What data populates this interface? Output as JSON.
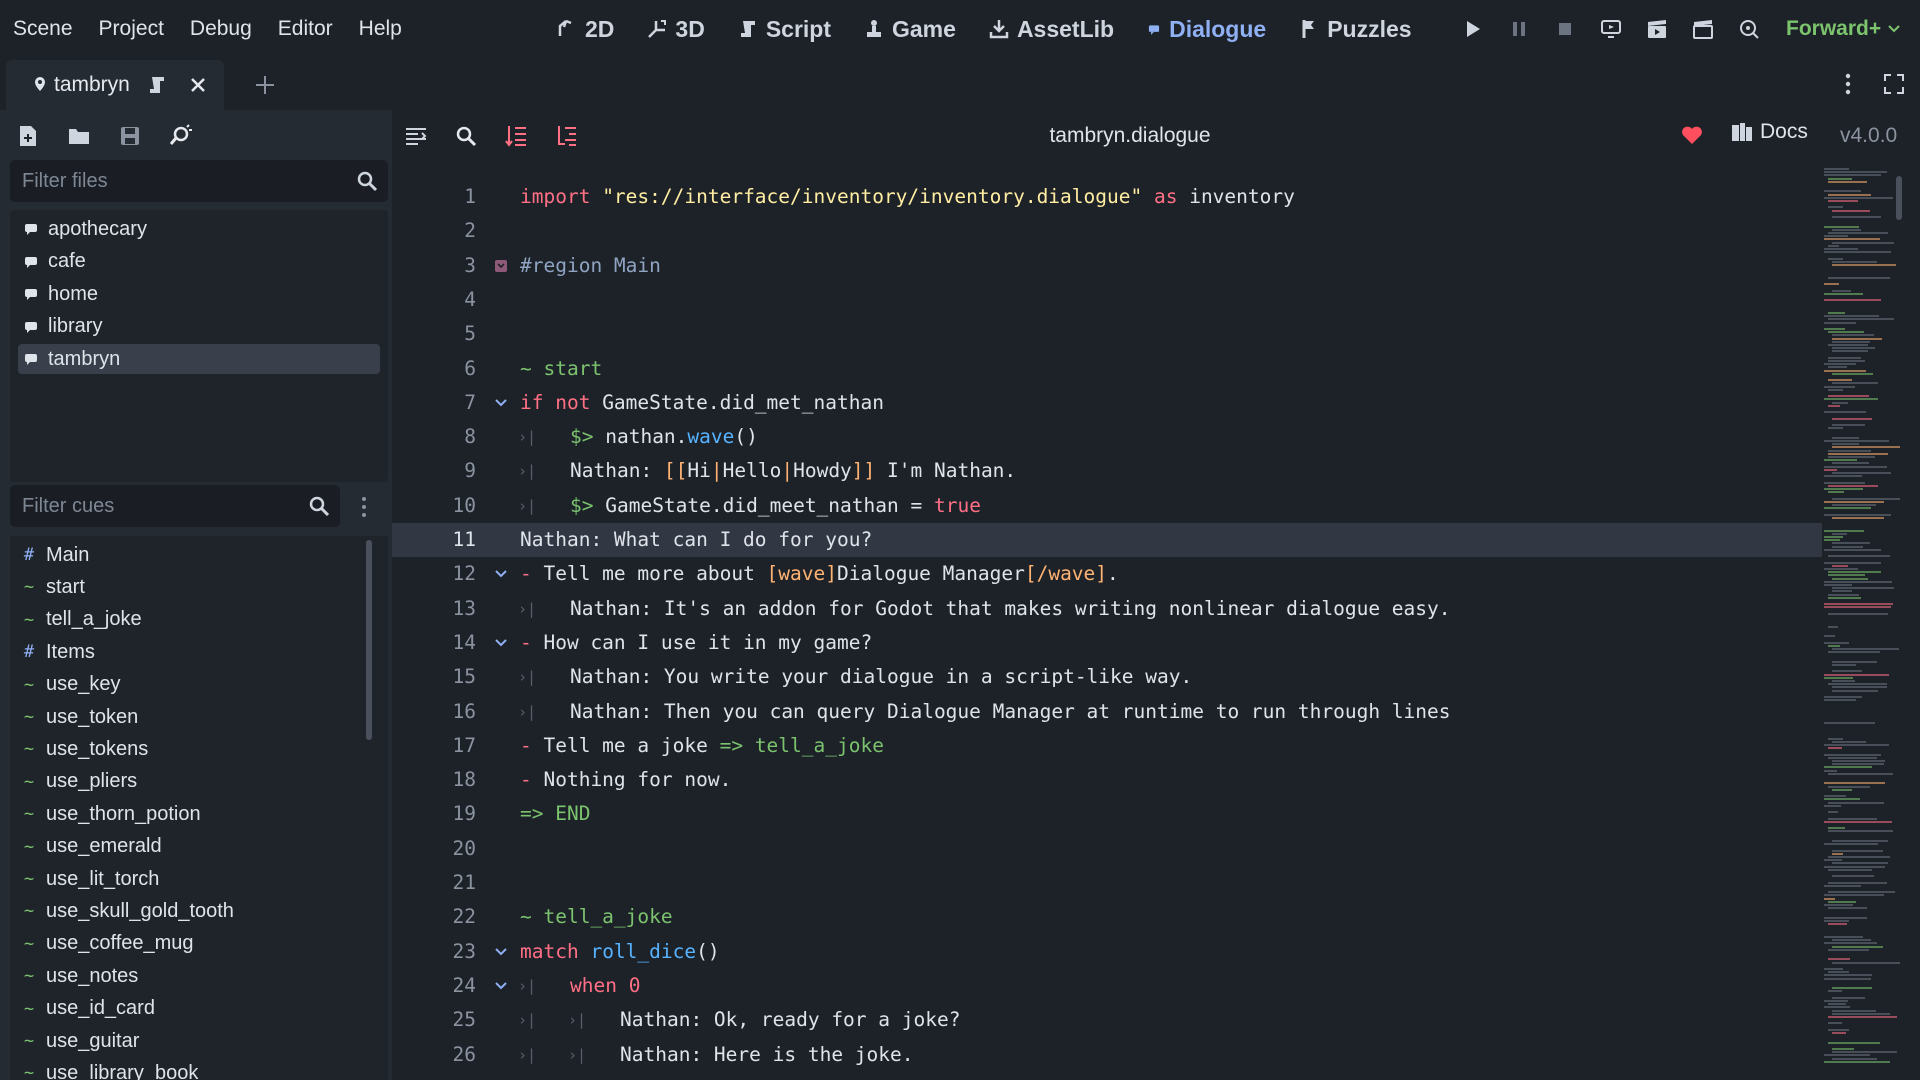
{
  "menu": [
    "Scene",
    "Project",
    "Debug",
    "Editor",
    "Help"
  ],
  "modes": [
    {
      "label": "2D",
      "icon": "2d-icon",
      "active": false
    },
    {
      "label": "3D",
      "icon": "3d-icon",
      "active": false
    },
    {
      "label": "Script",
      "icon": "script-icon",
      "active": false
    },
    {
      "label": "Game",
      "icon": "game-icon",
      "active": false
    },
    {
      "label": "AssetLib",
      "icon": "assetlib-icon",
      "active": false
    },
    {
      "label": "Dialogue",
      "icon": "dialogue-icon",
      "active": true
    },
    {
      "label": "Puzzles",
      "icon": "puzzles-icon",
      "active": false
    }
  ],
  "renderer": "Forward+",
  "tab": {
    "label": "tambryn"
  },
  "files_filter": {
    "placeholder": "Filter files"
  },
  "files": [
    {
      "name": "apothecary",
      "selected": false
    },
    {
      "name": "cafe",
      "selected": false
    },
    {
      "name": "home",
      "selected": false
    },
    {
      "name": "library",
      "selected": false
    },
    {
      "name": "tambryn",
      "selected": true
    }
  ],
  "cues_filter": {
    "placeholder": "Filter cues"
  },
  "cues": [
    {
      "mark": "#",
      "name": "Main"
    },
    {
      "mark": "~",
      "name": "start"
    },
    {
      "mark": "~",
      "name": "tell_a_joke"
    },
    {
      "mark": "#",
      "name": "Items"
    },
    {
      "mark": "~",
      "name": "use_key"
    },
    {
      "mark": "~",
      "name": "use_token"
    },
    {
      "mark": "~",
      "name": "use_tokens"
    },
    {
      "mark": "~",
      "name": "use_pliers"
    },
    {
      "mark": "~",
      "name": "use_thorn_potion"
    },
    {
      "mark": "~",
      "name": "use_emerald"
    },
    {
      "mark": "~",
      "name": "use_lit_torch"
    },
    {
      "mark": "~",
      "name": "use_skull_gold_tooth"
    },
    {
      "mark": "~",
      "name": "use_coffee_mug"
    },
    {
      "mark": "~",
      "name": "use_notes"
    },
    {
      "mark": "~",
      "name": "use_id_card"
    },
    {
      "mark": "~",
      "name": "use_guitar"
    },
    {
      "mark": "~",
      "name": "use_library_book"
    }
  ],
  "editor": {
    "filename": "tambryn.dialogue",
    "docs_label": "Docs",
    "version": "v4.0.0",
    "current_line": 11,
    "lines": [
      {
        "n": "1",
        "indent": 0,
        "fold": "",
        "parts": [
          [
            "kw",
            "import "
          ],
          [
            "str",
            "\"res://interface/inventory/inventory.dialogue\""
          ],
          [
            "kw",
            " as "
          ],
          [
            "",
            "inventory"
          ]
        ]
      },
      {
        "n": "2",
        "indent": 0,
        "fold": "",
        "parts": []
      },
      {
        "n": "3",
        "indent": 0,
        "fold": "region",
        "parts": [
          [
            "cmt",
            "#region Main"
          ]
        ]
      },
      {
        "n": "4",
        "indent": 0,
        "fold": "",
        "parts": []
      },
      {
        "n": "5",
        "indent": 0,
        "fold": "",
        "parts": []
      },
      {
        "n": "6",
        "indent": 0,
        "fold": "",
        "parts": [
          [
            "title",
            "~ start"
          ]
        ]
      },
      {
        "n": "7",
        "indent": 0,
        "fold": "down",
        "parts": [
          [
            "kw",
            "if not "
          ],
          [
            "",
            "GameState.did_met_nathan"
          ]
        ]
      },
      {
        "n": "8",
        "indent": 1,
        "fold": "",
        "parts": [
          [
            "op",
            "$> "
          ],
          [
            "",
            "nathan."
          ],
          [
            "fn",
            "wave"
          ],
          [
            "",
            "()"
          ]
        ]
      },
      {
        "n": "9",
        "indent": 1,
        "fold": "",
        "parts": [
          [
            "",
            "Nathan: "
          ],
          [
            "tag",
            "[["
          ],
          [
            "",
            "Hi"
          ],
          [
            "tag",
            "|"
          ],
          [
            "",
            "Hello"
          ],
          [
            "tag",
            "|"
          ],
          [
            "",
            "Howdy"
          ],
          [
            "tag",
            "]]"
          ],
          [
            "",
            " I'm Nathan."
          ]
        ]
      },
      {
        "n": "10",
        "indent": 1,
        "fold": "",
        "parts": [
          [
            "op",
            "$> "
          ],
          [
            "",
            "GameState.did_meet_nathan = "
          ],
          [
            "bool",
            "true"
          ]
        ]
      },
      {
        "n": "11",
        "indent": 0,
        "fold": "",
        "parts": [
          [
            "",
            "Nathan: What can I do for you?"
          ]
        ]
      },
      {
        "n": "12",
        "indent": 0,
        "fold": "down",
        "parts": [
          [
            "kw",
            "- "
          ],
          [
            "",
            "Tell me more about "
          ],
          [
            "tag",
            "[wave]"
          ],
          [
            "",
            "Dialogue Manager"
          ],
          [
            "tag",
            "[/wave]"
          ],
          [
            "",
            "."
          ]
        ]
      },
      {
        "n": "13",
        "indent": 1,
        "fold": "",
        "parts": [
          [
            "",
            "Nathan: It's an addon for Godot that makes writing nonlinear dialogue easy."
          ]
        ]
      },
      {
        "n": "14",
        "indent": 0,
        "fold": "down",
        "parts": [
          [
            "kw",
            "- "
          ],
          [
            "",
            "How can I use it in my game?"
          ]
        ]
      },
      {
        "n": "15",
        "indent": 1,
        "fold": "",
        "parts": [
          [
            "",
            "Nathan: You write your dialogue in a script-like way."
          ]
        ]
      },
      {
        "n": "16",
        "indent": 1,
        "fold": "",
        "parts": [
          [
            "",
            "Nathan: Then you can query Dialogue Manager at runtime to run through lines"
          ]
        ]
      },
      {
        "n": "17",
        "indent": 0,
        "fold": "",
        "parts": [
          [
            "kw",
            "- "
          ],
          [
            "",
            "Tell me a joke "
          ],
          [
            "op",
            "=> tell_a_joke"
          ]
        ]
      },
      {
        "n": "18",
        "indent": 0,
        "fold": "",
        "parts": [
          [
            "kw",
            "- "
          ],
          [
            "",
            "Nothing for now."
          ]
        ]
      },
      {
        "n": "19",
        "indent": 0,
        "fold": "",
        "parts": [
          [
            "op",
            "=> END"
          ]
        ]
      },
      {
        "n": "20",
        "indent": 0,
        "fold": "",
        "parts": []
      },
      {
        "n": "21",
        "indent": 0,
        "fold": "",
        "parts": []
      },
      {
        "n": "22",
        "indent": 0,
        "fold": "",
        "parts": [
          [
            "title",
            "~ tell_a_joke"
          ]
        ]
      },
      {
        "n": "23",
        "indent": 0,
        "fold": "down",
        "parts": [
          [
            "kw",
            "match "
          ],
          [
            "fn",
            "roll_dice"
          ],
          [
            "",
            "()"
          ]
        ]
      },
      {
        "n": "24",
        "indent": 1,
        "fold": "down",
        "parts": [
          [
            "kw",
            "when "
          ],
          [
            "bool",
            "0"
          ]
        ]
      },
      {
        "n": "25",
        "indent": 2,
        "fold": "",
        "parts": [
          [
            "",
            "Nathan: Ok, ready for a joke?"
          ]
        ]
      },
      {
        "n": "26",
        "indent": 2,
        "fold": "",
        "parts": [
          [
            "",
            "Nathan: Here is the joke."
          ]
        ]
      }
    ]
  },
  "colors": {
    "accent": "#8fb0f2",
    "renderer": "#7cc36e",
    "heart": "#ff4f5e",
    "keyword": "#ff7085",
    "string": "#ffeda1"
  }
}
